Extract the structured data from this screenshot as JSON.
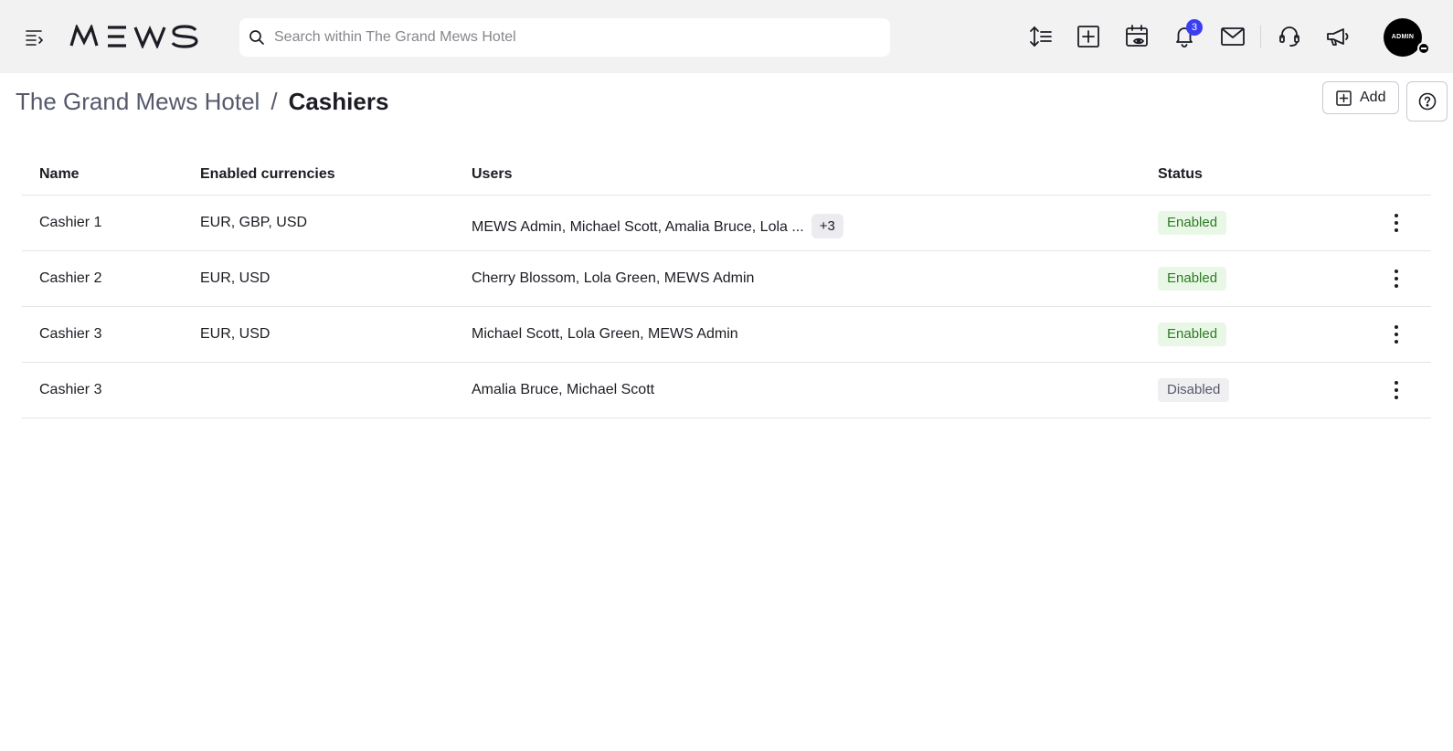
{
  "header": {
    "logo_text": "MEWS",
    "search": {
      "placeholder": "Search within The Grand Mews Hotel",
      "value": ""
    },
    "notifications_count": "3",
    "avatar_label": "ADMIN"
  },
  "page": {
    "breadcrumb_parent": "The Grand Mews Hotel",
    "breadcrumb_separator": "/",
    "title": "Cashiers",
    "add_label": "Add"
  },
  "table": {
    "columns": {
      "name": "Name",
      "currencies": "Enabled currencies",
      "users": "Users",
      "status": "Status"
    },
    "rows": [
      {
        "name": "Cashier 1",
        "currencies": "EUR, GBP, USD",
        "users": "MEWS Admin, Michael Scott, Amalia Bruce, Lola ...",
        "more": "+3",
        "status": "Enabled"
      },
      {
        "name": "Cashier 2",
        "currencies": "EUR, USD",
        "users": "Cherry Blossom, Lola Green, MEWS Admin",
        "more": "",
        "status": "Enabled"
      },
      {
        "name": "Cashier 3",
        "currencies": "EUR, USD",
        "users": "Michael Scott, Lola Green, MEWS Admin",
        "more": "",
        "status": "Enabled"
      },
      {
        "name": "Cashier 3",
        "currencies": "",
        "users": "Amalia Bruce, Michael Scott",
        "more": "",
        "status": "Disabled"
      }
    ]
  },
  "colors": {
    "topbar_bg": "#f2f2f2",
    "badge_bg": "#3b3df2",
    "enabled_bg": "#e9f8e6",
    "enabled_text": "#2d7a24",
    "disabled_bg": "#efeff2",
    "disabled_text": "#55596b"
  },
  "icons": {
    "menu": "menu-collapse-icon",
    "search": "search-icon",
    "toolbar": [
      "line-spacing-icon",
      "plus-square-icon",
      "calendar-eye-icon",
      "bell-icon",
      "mail-icon",
      "headset-icon",
      "megaphone-icon"
    ],
    "add": "plus-square-icon",
    "help": "help-circle-icon",
    "row_menu": "kebab-menu-icon"
  }
}
